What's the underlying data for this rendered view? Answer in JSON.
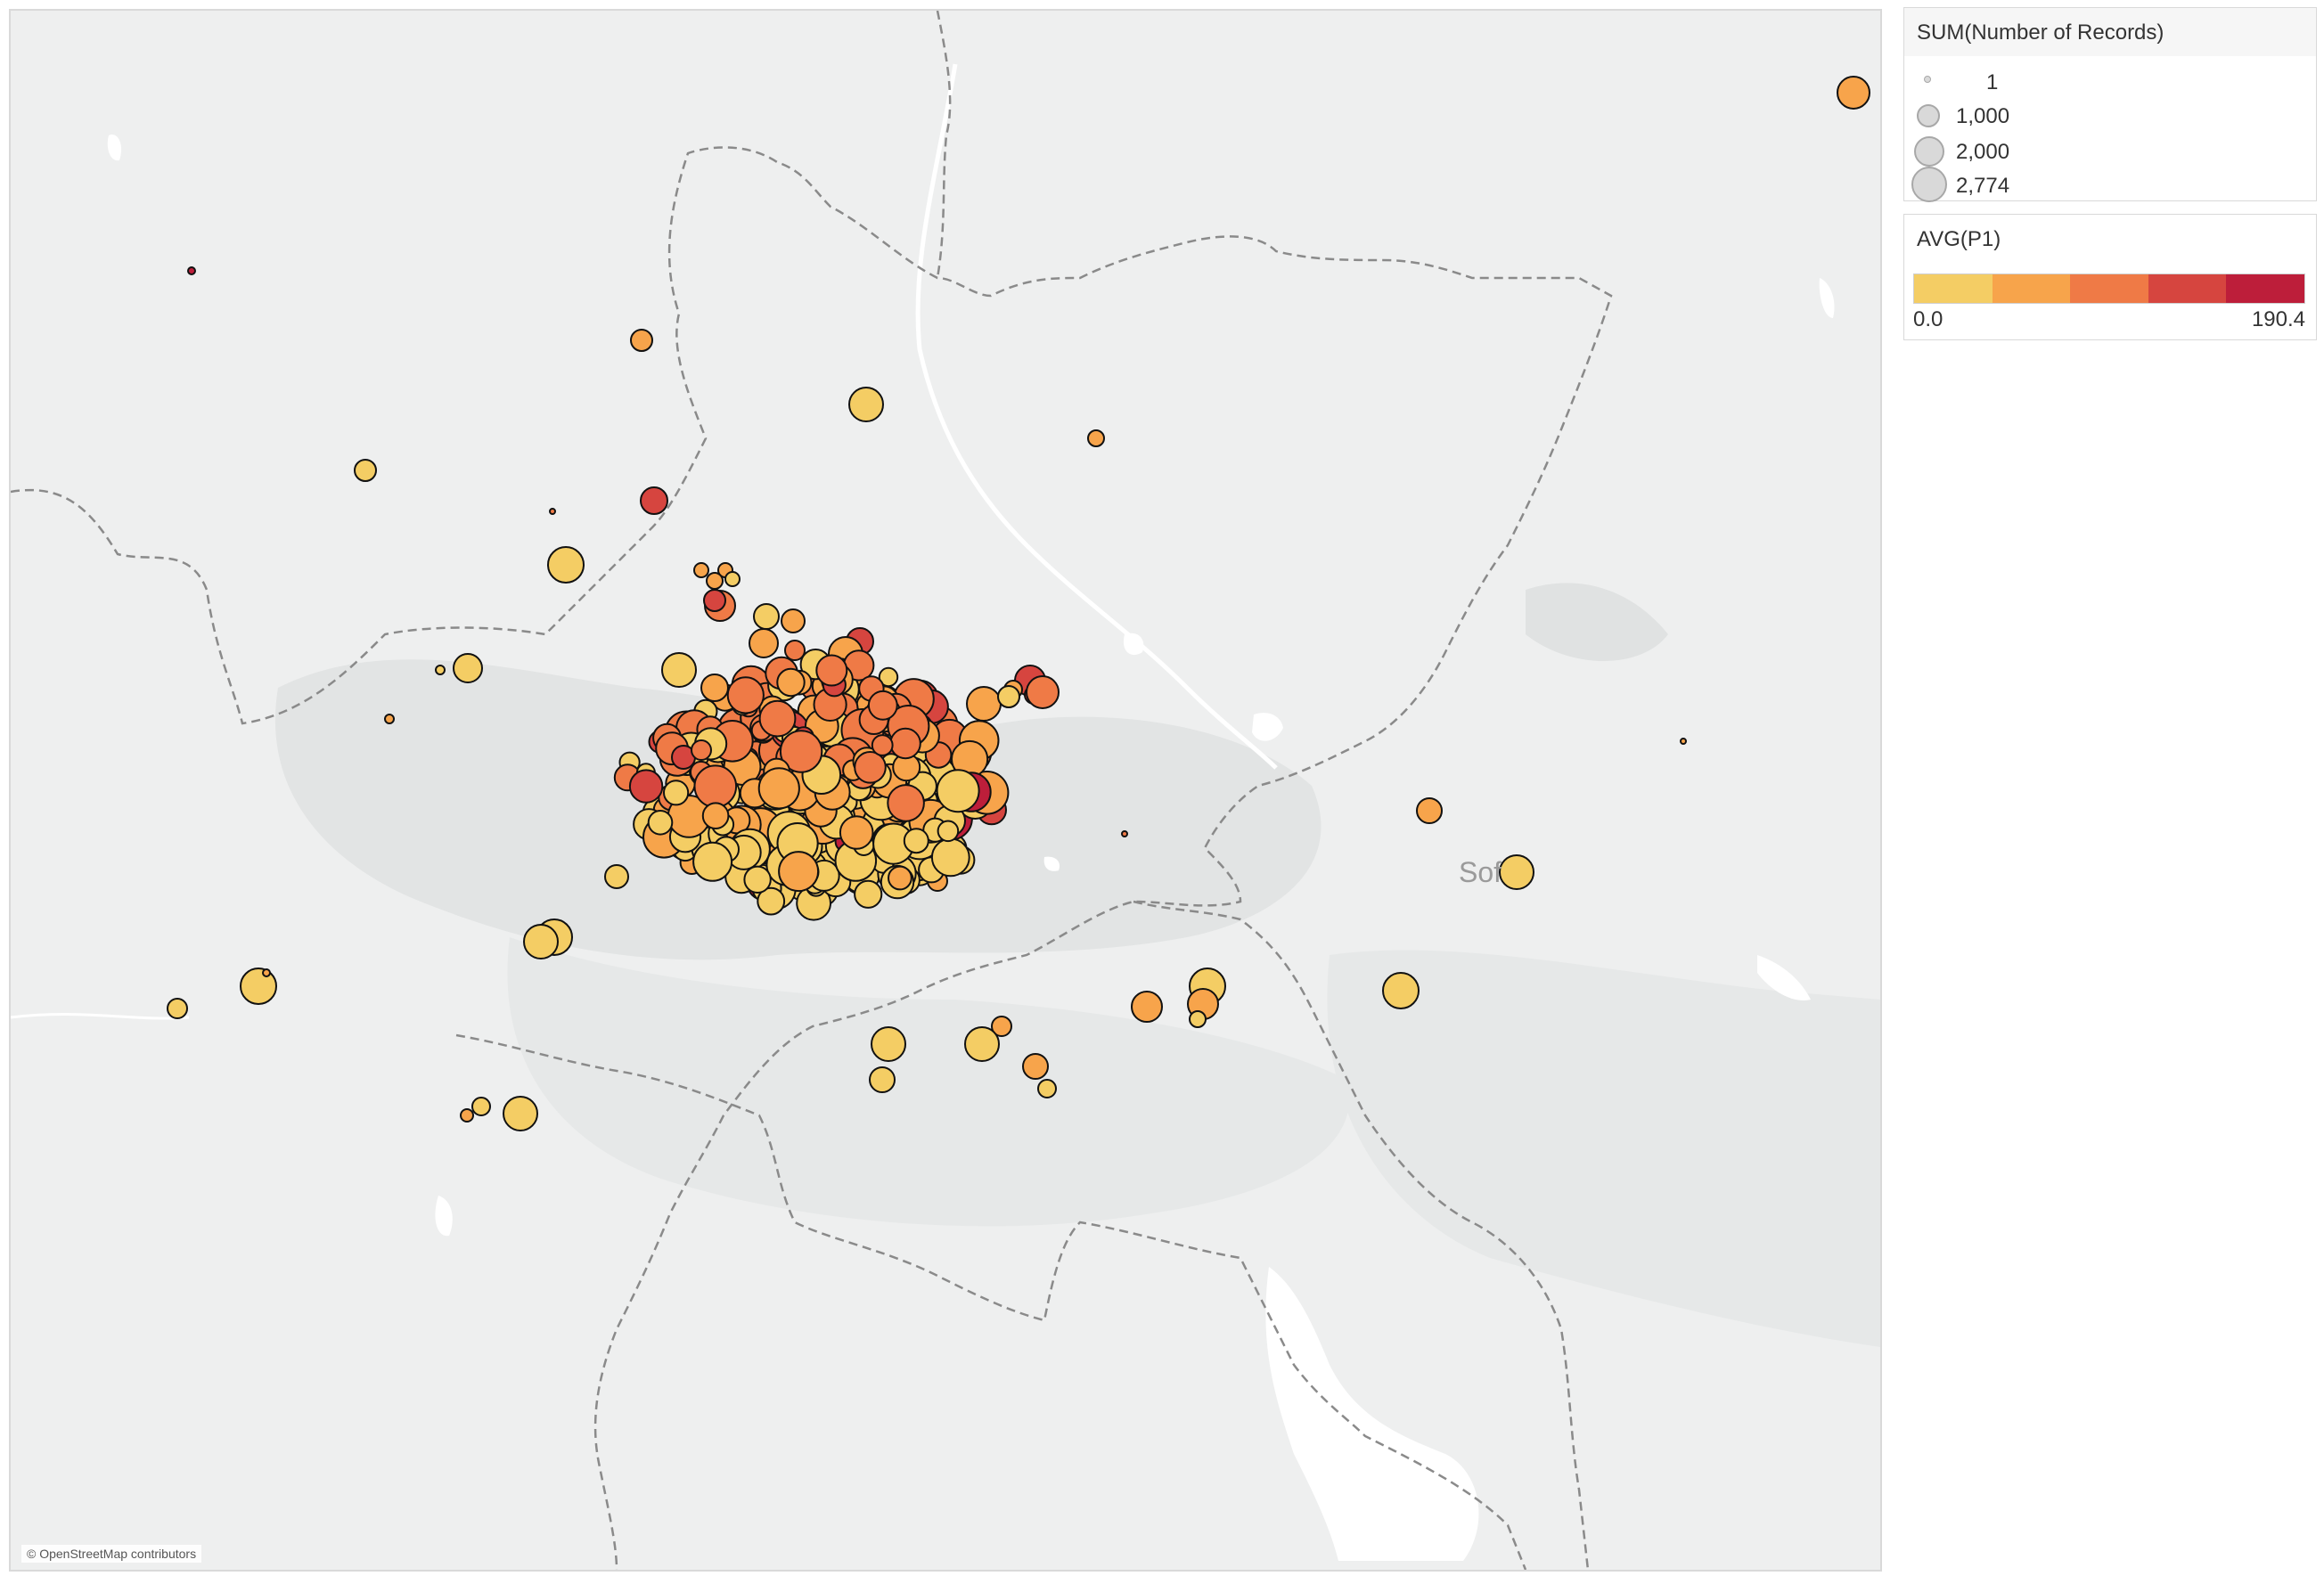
{
  "map": {
    "attribution": "© OpenStreetMap contributors",
    "place_label": "Sof",
    "colors": {
      "land": "#eeefef",
      "urban": "#e2e4e4",
      "water": "#ffffff",
      "boundary": "#8a8a8a",
      "marker_stroke": "#111111"
    }
  },
  "size_legend": {
    "title": "SUM(Number of Records)",
    "items": [
      {
        "label": "1",
        "value": 1
      },
      {
        "label": "1,000",
        "value": 1000
      },
      {
        "label": "2,000",
        "value": 2000
      },
      {
        "label": "2,774",
        "value": 2774
      }
    ]
  },
  "color_legend": {
    "title": "AVG(P1)",
    "min_label": "0.0",
    "max_label": "190.4",
    "ramp_colors": [
      "#f4cd64",
      "#f7a44b",
      "#ef7a46",
      "#d6453f",
      "#bd1e3a"
    ]
  },
  "chart_data": {
    "type": "scatter",
    "description_of_encoding": "circle size = SUM(Number of Records); circle color = AVG(P1)",
    "size_range": [
      1,
      2774
    ],
    "color_range": [
      0.0,
      190.4
    ]
  }
}
